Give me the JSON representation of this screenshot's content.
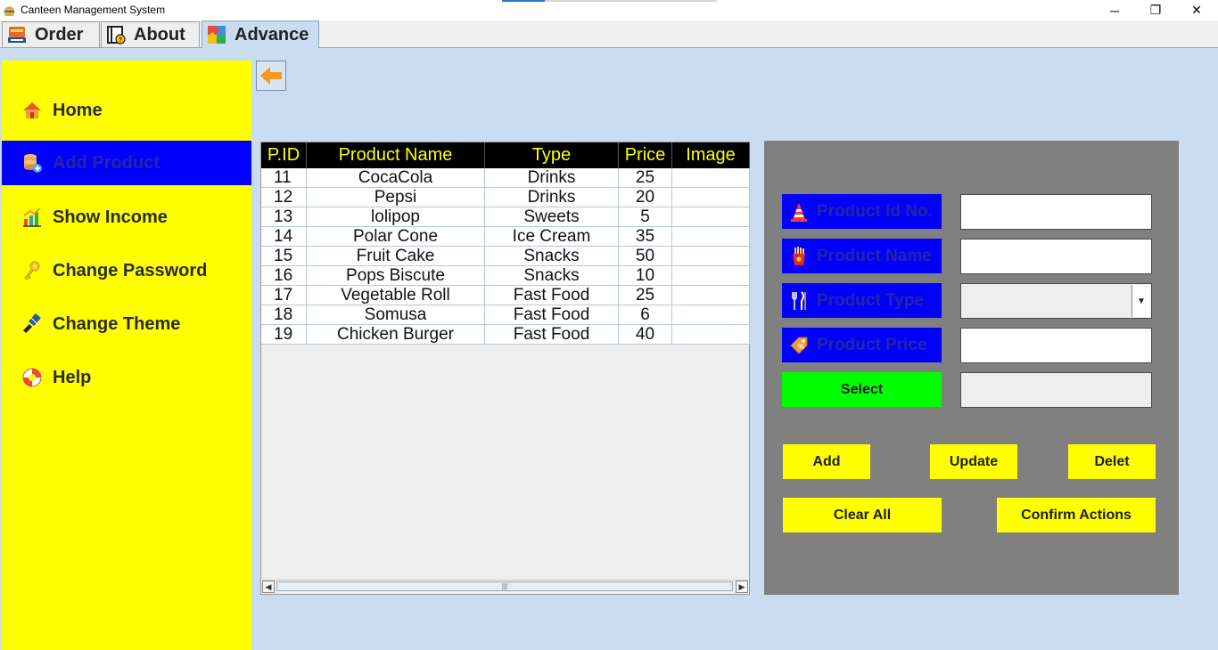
{
  "window": {
    "title": "Canteen Management System",
    "controls": {
      "minimize": "─",
      "maximize": "❐",
      "close": "✕"
    }
  },
  "tabs": [
    {
      "label": "Order",
      "icon": "order-icon"
    },
    {
      "label": "About",
      "icon": "book-icon"
    },
    {
      "label": "Advance",
      "icon": "puzzle-icon",
      "active": true
    }
  ],
  "sidebar": {
    "items": [
      {
        "label": "Home",
        "icon": "home-icon"
      },
      {
        "label": "Add Product",
        "icon": "database-add-icon",
        "active": true
      },
      {
        "label": "Show Income",
        "icon": "bar-chart-icon"
      },
      {
        "label": "Change Password",
        "icon": "key-icon"
      },
      {
        "label": "Change Theme",
        "icon": "paint-brush-icon"
      },
      {
        "label": "Help",
        "icon": "lifebuoy-icon"
      }
    ]
  },
  "back_button": {
    "icon": "arrow-left-icon"
  },
  "table": {
    "columns": [
      "P.ID",
      "Product Name",
      "Type",
      "Price",
      "Image"
    ],
    "rows": [
      [
        "11",
        "CocaCola",
        "Drinks",
        "25",
        ""
      ],
      [
        "12",
        "Pepsi",
        "Drinks",
        "20",
        ""
      ],
      [
        "13",
        "lolipop",
        "Sweets",
        "5",
        ""
      ],
      [
        "14",
        "Polar Cone",
        "Ice Cream",
        "35",
        ""
      ],
      [
        "15",
        "Fruit Cake",
        "Snacks",
        "50",
        ""
      ],
      [
        "16",
        "Pops Biscute",
        "Snacks",
        "10",
        ""
      ],
      [
        "17",
        "Vegetable Roll",
        "Fast Food",
        "25",
        ""
      ],
      [
        "18",
        "Somusa",
        "Fast Food",
        "6",
        ""
      ],
      [
        "19",
        "Chicken Burger",
        "Fast Food",
        "40",
        ""
      ]
    ]
  },
  "form": {
    "product_id": {
      "label": "Product Id No.",
      "icon": "cone-icon",
      "value": ""
    },
    "product_name": {
      "label": "Product Name",
      "icon": "fries-icon",
      "value": ""
    },
    "product_type": {
      "label": "Product Type",
      "icon": "cutlery-icon",
      "value": ""
    },
    "product_price": {
      "label": "Product Price",
      "icon": "price-tag-icon",
      "value": ""
    },
    "select_button": "Select",
    "image_path": ""
  },
  "actions": {
    "add": "Add",
    "update": "Update",
    "delete": "Delet",
    "clear_all": "Clear All",
    "confirm": "Confirm Actions"
  },
  "colors": {
    "sidebar_bg": "#ffff00",
    "active_item_bg": "#0000ff",
    "content_bg": "#c9dcf0",
    "form_panel_bg": "#808080",
    "select_button_bg": "#00ff00",
    "action_button_bg": "#ffff00",
    "table_header_bg": "#000000",
    "table_header_text": "#ffff00"
  }
}
